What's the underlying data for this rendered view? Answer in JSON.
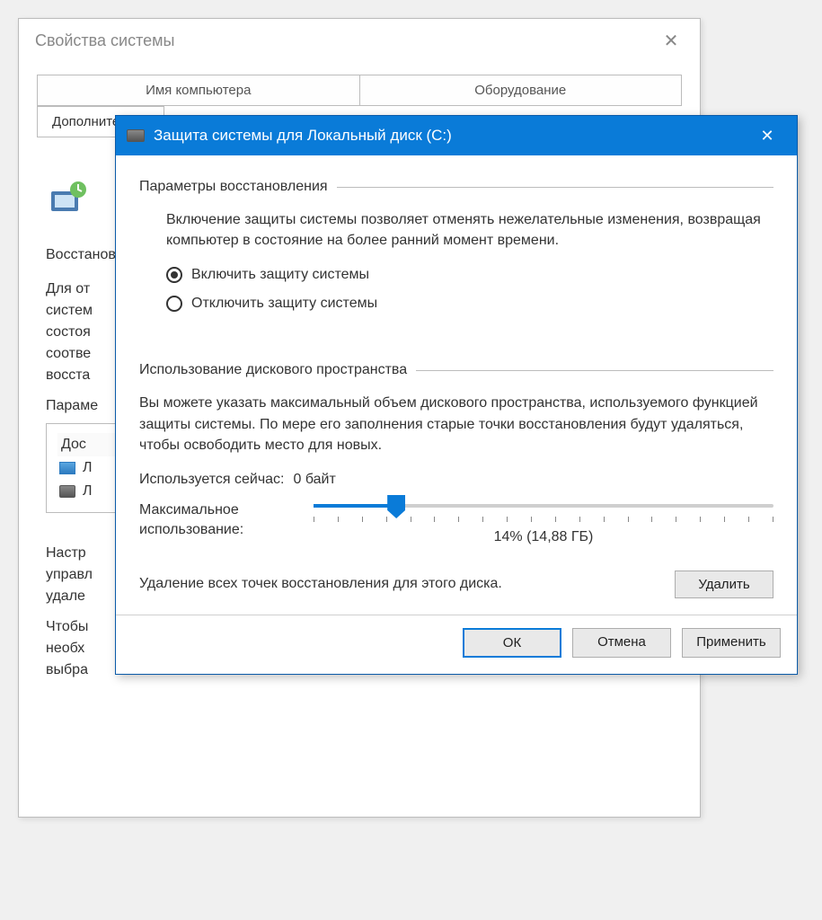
{
  "bg": {
    "title": "Свойства системы",
    "tabs_row1": [
      "Имя компьютера",
      "Оборудование"
    ],
    "tab_active": "Дополнительно",
    "restore_label": "Восстановление",
    "body_lines": [
      "Для от",
      "систем",
      "состоя",
      "соотве",
      "восста"
    ],
    "params_label": "Параме",
    "inset_header": "Дос",
    "drives": [
      "Л",
      "Л"
    ],
    "tail_lines": [
      "Настр",
      "управл",
      "удале",
      "Чтобы",
      "необх",
      "выбра"
    ]
  },
  "dlg": {
    "title": "Защита системы для Локальный диск (C:)",
    "group1": "Параметры восстановления",
    "desc1": "Включение защиты системы позволяет отменять нежелательные изменения, возвращая компьютер в состояние на более ранний момент времени.",
    "radio_on": "Включить защиту системы",
    "radio_off": "Отключить защиту системы",
    "group2": "Использование дискового пространства",
    "desc2": "Вы можете указать максимальный объем дискового пространства, используемого функцией защиты системы. По мере его заполнения старые точки восстановления будут удаляться, чтобы освободить место для новых.",
    "used_label": "Используется сейчас:",
    "used_value": "0 байт",
    "max_label": "Максимальное использование:",
    "max_value": "14% (14,88 ГБ)",
    "slider_percent": 14,
    "delete_text": "Удаление всех точек восстановления для этого диска.",
    "btn_delete": "Удалить",
    "btn_ok": "ОК",
    "btn_cancel": "Отмена",
    "btn_apply": "Применить"
  }
}
